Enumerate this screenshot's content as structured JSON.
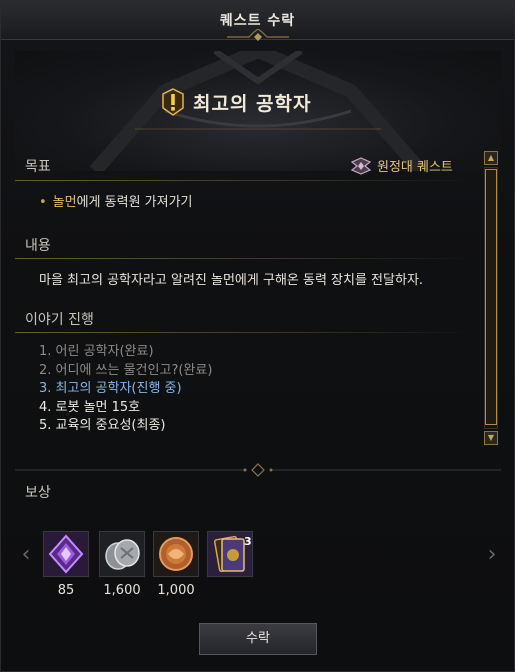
{
  "window": {
    "title": "퀘스트 수락"
  },
  "quest": {
    "name": "최고의 공학자",
    "type_label": "원정대 퀘스트"
  },
  "sections": {
    "objective_title": "목표",
    "objective": {
      "highlight": "놀먼",
      "rest": "에게 동력원 가져가기"
    },
    "content_title": "내용",
    "content_text": "마을 최고의 공학자라고 알려진 놀먼에게 구해온 동력 장치를 전달하자.",
    "story_title": "이야기 진행",
    "story_steps": [
      {
        "text": "1. 어린 공학자(완료)",
        "state": "done"
      },
      {
        "text": "2. 어디에 쓰는 물건인고?(완료)",
        "state": "done"
      },
      {
        "text": "3. 최고의 공학자(진행 중)",
        "state": "current"
      },
      {
        "text": "4. 로봇 놀먼 15호",
        "state": "todo"
      },
      {
        "text": "5. 교육의 중요성(최종)",
        "state": "todo"
      }
    ]
  },
  "rewards": {
    "title": "보상",
    "items": [
      {
        "icon": "purple-crystal-icon",
        "qty": "85"
      },
      {
        "icon": "silver-coins-icon",
        "qty": "1,600"
      },
      {
        "icon": "bronze-medal-icon",
        "qty": "1,000"
      },
      {
        "icon": "card-pack-icon",
        "qty": "",
        "count": "3"
      }
    ]
  },
  "buttons": {
    "accept": "수락"
  },
  "colors": {
    "accent_gold": "#e3c575",
    "current_step": "#86b7ea",
    "done_step": "#8e8b86"
  }
}
